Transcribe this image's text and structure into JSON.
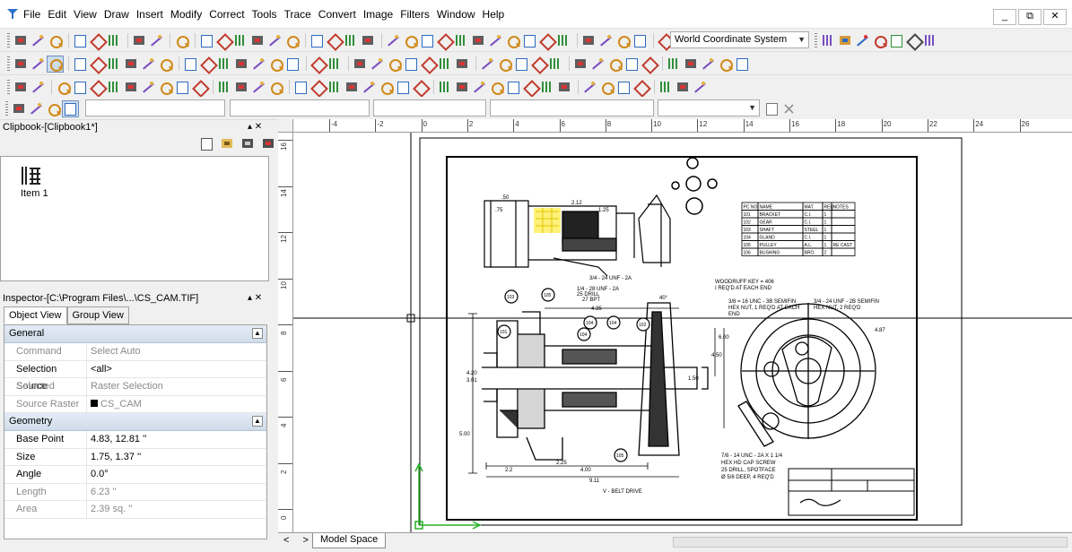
{
  "menu": {
    "items": [
      "File",
      "Edit",
      "View",
      "Draw",
      "Insert",
      "Modify",
      "Correct",
      "Tools",
      "Trace",
      "Convert",
      "Image",
      "Filters",
      "Window",
      "Help"
    ]
  },
  "window_controls": [
    "_",
    "⧉",
    "✕"
  ],
  "toolbar": {
    "coordinate_system": "World Coordinate System"
  },
  "clipbook": {
    "title": "Clipbook-[Clipbook1*]",
    "item_label": "Item 1"
  },
  "inspector": {
    "title": "Inspector-[C:\\Program Files\\...\\CS_CAM.TIF]",
    "tabs": [
      "Object View",
      "Group View"
    ],
    "general_label": "General",
    "geometry_label": "Geometry",
    "general_rows": [
      {
        "k": "Command",
        "v": "Select Auto",
        "dim": true
      },
      {
        "k": "Selection Source",
        "v": "<all>",
        "dim": false
      },
      {
        "k": "Selected",
        "v": "Raster Selection",
        "dim": true
      },
      {
        "k": "Source Raster",
        "v": "CS_CAM",
        "dim": true
      }
    ],
    "geometry_rows": [
      {
        "k": "Base Point",
        "v": "4.83, 12.81 ''",
        "dim": false
      },
      {
        "k": "Size",
        "v": "1.75, 1.37 ''",
        "dim": false
      },
      {
        "k": "Angle",
        "v": "0.0°",
        "dim": false
      },
      {
        "k": "Length",
        "v": "6.23 ''",
        "dim": true
      },
      {
        "k": "Area",
        "v": "2.39 sq. ''",
        "dim": true
      }
    ]
  },
  "rulers": {
    "h_labels": [
      "-4",
      "-2",
      "0",
      "2",
      "4",
      "6",
      "8",
      "10",
      "12",
      "14",
      "16",
      "18",
      "20",
      "22",
      "24",
      "26"
    ],
    "v_labels": [
      "16",
      "14",
      "12",
      "10",
      "8",
      "6",
      "4",
      "2",
      "0"
    ]
  },
  "drawing": {
    "parts_table": {
      "header": [
        "PC NO.",
        "NAME",
        "MAT.",
        "REQ",
        "NOTES"
      ],
      "rows": [
        [
          "101",
          "BRACKET",
          "C.I.",
          "1",
          ""
        ],
        [
          "102",
          "GEAR",
          "C.I.",
          "1",
          ""
        ],
        [
          "103",
          "SHAFT",
          "STEEL",
          "1",
          ""
        ],
        [
          "104",
          "GLAND",
          "C.I.",
          "1",
          ""
        ],
        [
          "105",
          "PULLEY",
          "A.L.",
          "1",
          "RE CAST"
        ],
        [
          "106",
          "BUSHING",
          "BRO.",
          "2",
          ""
        ]
      ]
    },
    "notes": {
      "woodruff": "WOODRUFF KEY = 406",
      "woodruff2": "I REQ'D AT EACH END",
      "bolt1": "3/8 = 16 UNC - 3B SEMIFIN",
      "bolt2": "HEX NUT, 1 REQ'D AT EACH",
      "bolt3": "END",
      "nut1": "3/4 - 24 UNF - 2B SEMIFIN",
      "nut2": "HEX NUT, 2 REQ'D",
      "cap1": "7/8 - 14 UNC - 2A X 1 1/4",
      "cap2": "HEX HD CAP SCREW",
      "cap3": "25 DRILL, SPOTFACE",
      "cap4": "Ø 5/8 DEEP, 4 REQ'D",
      "belt": "V - BELT DRIVE",
      "thread_top": "3/4 - 24 UNF - 2A",
      "thread_mid": "1/4 - 28 UNF - 2A",
      "drill": "25 DRILL",
      "dims": {
        "d50": ".50",
        "d75": ".75",
        "d212": "2.12",
        "d125": "1.25",
        "d27": "27 BPT",
        "d435": "4.35",
        "d40": "40°",
        "d600": "6.00",
        "d450": "4.50",
        "d420": "4.20",
        "d301": "3.01",
        "d500": "5.00",
        "d22": "2.2",
        "d235": "2.25",
        "d400": "4.00",
        "d911": "9.11",
        "d150": "1.50",
        "d487": "4.87"
      },
      "balloons": [
        "103",
        "105",
        "104",
        "104",
        "101",
        "104",
        "102",
        "105"
      ]
    }
  },
  "bottom": {
    "nav": "< >",
    "model_space": "Model Space"
  }
}
